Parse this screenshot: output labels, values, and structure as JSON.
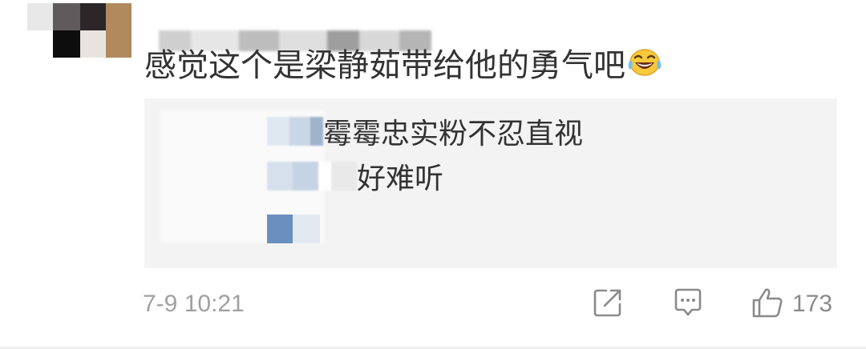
{
  "comment": {
    "text": "感觉这个是梁静茹带给他的勇气吧",
    "emoji": "laughing-with-tears"
  },
  "replies": [
    {
      "text": "霉霉忠实粉不忍直视"
    },
    {
      "text": "好难听"
    },
    {
      "text": ""
    }
  ],
  "footer": {
    "timestamp": "7-9 10:21",
    "like_count": "173"
  },
  "colors": {
    "text": "#333333",
    "meta": "#a0a0a0",
    "reply_bg": "#f3f3f3",
    "icon": "#8a8a8a",
    "mosaic_blue": "#6b8fbf"
  }
}
